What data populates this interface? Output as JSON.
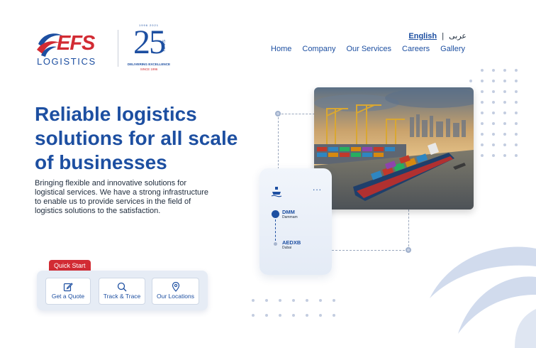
{
  "brand": {
    "logo_text": "EFS",
    "logo_subtext": "LOGISTICS",
    "anniversary_years_range": "1996 2021",
    "anniversary_number": "25",
    "anniversary_word": "YEARS",
    "anniversary_tagline": "DELIVERING EXCELLENCE",
    "anniversary_since": "SINCE 1996",
    "colors": {
      "primary": "#1d4fa1",
      "accent": "#d22b33"
    }
  },
  "language": {
    "english": "English",
    "separator": "|",
    "arabic": "عربى"
  },
  "nav": {
    "items": [
      "Home",
      "Company",
      "Our Services",
      "Careers",
      "Gallery"
    ]
  },
  "hero": {
    "title": "Reliable logistics solutions for all scale of businesses",
    "description": "Bringing flexible and innovative solutions for logistical services. We have a strong infrastructure to enable us to provide services in the field of logistics solutions to the satisfaction."
  },
  "quick_start": {
    "label": "Quick Start",
    "buttons": [
      {
        "label": "Get a Quote",
        "icon": "edit-icon"
      },
      {
        "label": "Track & Trace",
        "icon": "search-icon"
      },
      {
        "label": "Our Locations",
        "icon": "location-pin-icon"
      }
    ]
  },
  "tracking_card": {
    "icon": "ship-icon",
    "more": "...",
    "origin_code": "DMM",
    "origin_city": "Dammam",
    "destination_code": "AEDXB",
    "destination_city": "Dubai"
  },
  "hero_image": {
    "icon": "cargo-ship-image"
  }
}
